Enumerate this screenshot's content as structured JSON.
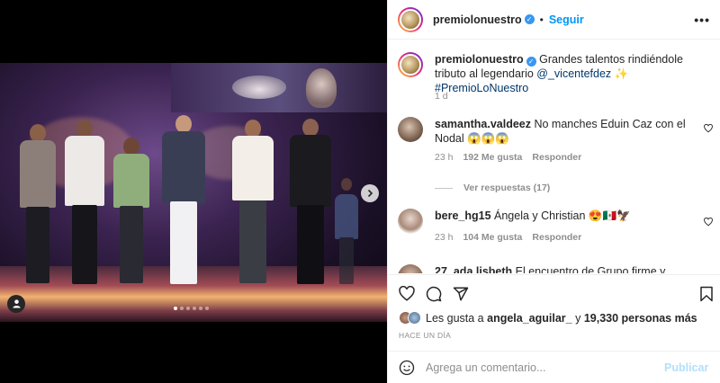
{
  "post": {
    "username": "premiolonuestro",
    "follow_label": "Seguir",
    "more_label": "•••",
    "verified_mark": "✓",
    "caption": {
      "text": "Grandes talentos rindiéndole tributo al legendario",
      "mention": "@_vicentefdez",
      "sparkle": "✨",
      "hashtag": "#PremioLoNuestro"
    },
    "caption_age": "1 d"
  },
  "comments": [
    {
      "username": "samantha.valdeez",
      "text": "No manches Eduin Caz con el Nodal 😱😱😱",
      "age": "23 h",
      "likes": "192 Me gusta",
      "reply": "Responder"
    },
    {
      "username": "bere_hg15",
      "text": "Ángela y Christian 😍🇲🇽🦅",
      "age": "23 h",
      "likes": "104 Me gusta",
      "reply": "Responder"
    },
    {
      "username": "27_ada.lisbeth",
      "text": "El encuentro de Grupo firme y Nodal!!👏👏👏"
    }
  ],
  "view_replies": "Ver respuestas (17)",
  "likes": {
    "prefix": "Les gusta a",
    "user": "angela_aguilar_",
    "connector": "y",
    "count": "19,330 personas más"
  },
  "date_label": "HACE UN DÍA",
  "add_comment": {
    "placeholder": "Agrega un comentario...",
    "publish": "Publicar"
  },
  "carousel": {
    "slides": 6,
    "active": 0
  },
  "colors": {
    "link_blue": "#0095f6",
    "mention_blue": "#00376b",
    "muted": "#8e8e8e",
    "publish_disabled": "#b2dffc"
  },
  "icons": [
    "heart-icon",
    "comment-icon",
    "share-icon",
    "bookmark-icon",
    "emoji-icon",
    "chevron-right-icon",
    "user-tag-icon",
    "more-icon",
    "verified-icon"
  ]
}
